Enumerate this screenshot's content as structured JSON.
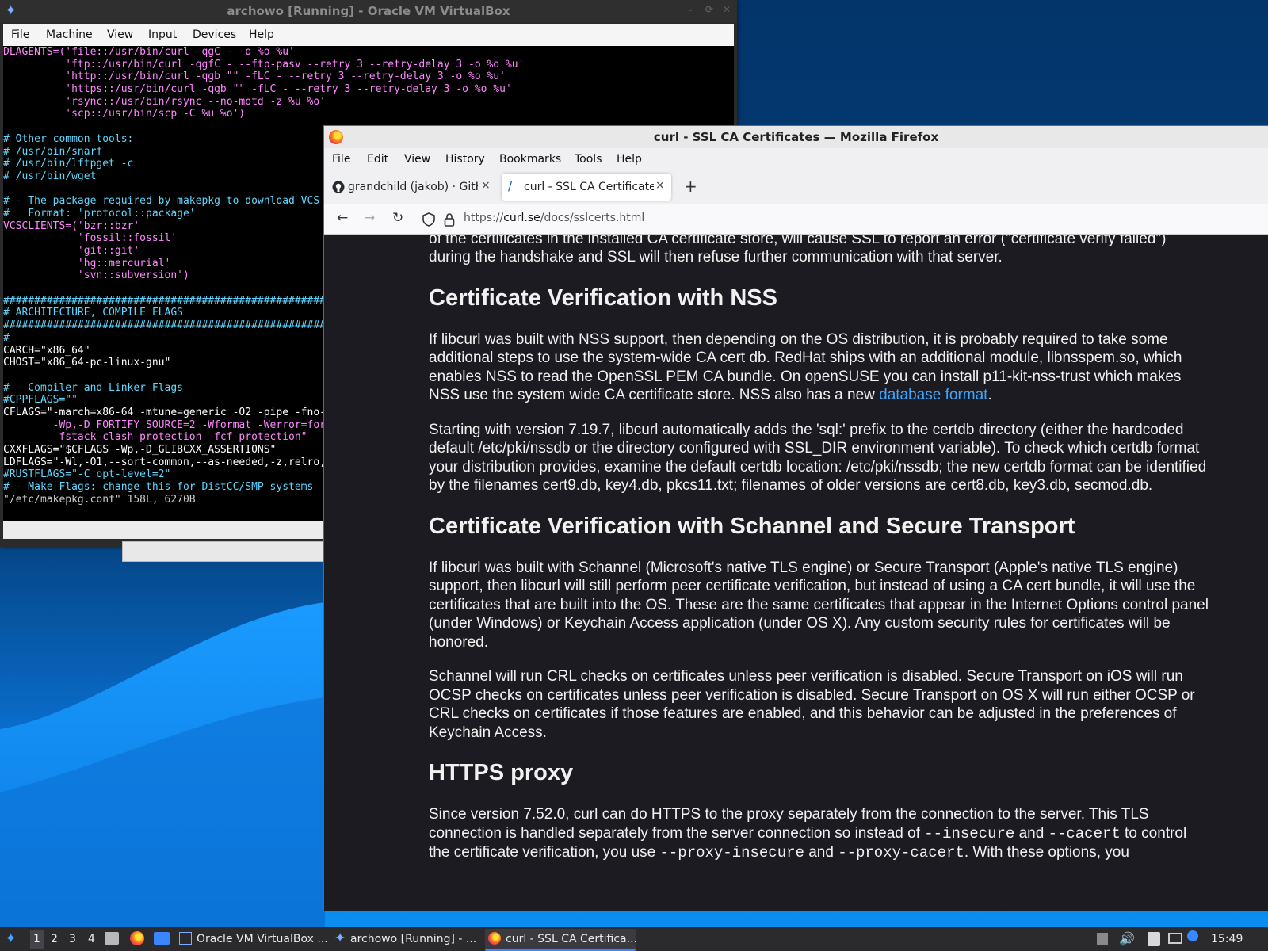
{
  "vbox": {
    "title": "archowo [Running] - Oracle VM VirtualBox",
    "menu": [
      "File",
      "Machine",
      "View",
      "Input",
      "Devices",
      "Help"
    ],
    "terminal_lines": [
      {
        "c": "t-s",
        "t": "DLAGENTS=('file::/usr/bin/curl -qgC - -o %o %u'"
      },
      {
        "c": "t-s",
        "t": "          'ftp::/usr/bin/curl -qgfC - --ftp-pasv --retry 3 --retry-delay 3 -o %o %u'"
      },
      {
        "c": "t-s",
        "t": "          'http::/usr/bin/curl -qgb \"\" -fLC - --retry 3 --retry-delay 3 -o %o %u'"
      },
      {
        "c": "t-s",
        "t": "          'https::/usr/bin/curl -qgb \"\" -fLC - --retry 3 --retry-delay 3 -o %o %u'"
      },
      {
        "c": "t-s",
        "t": "          'rsync::/usr/bin/rsync --no-motd -z %u %o'"
      },
      {
        "c": "t-s",
        "t": "          'scp::/usr/bin/scp -C %u %o')"
      },
      {
        "c": "t-c",
        "t": ""
      },
      {
        "c": "t-c",
        "t": "# Other common tools:"
      },
      {
        "c": "t-c",
        "t": "# /usr/bin/snarf"
      },
      {
        "c": "t-c",
        "t": "# /usr/bin/lftpget -c"
      },
      {
        "c": "t-c",
        "t": "# /usr/bin/wget"
      },
      {
        "c": "t-c",
        "t": ""
      },
      {
        "c": "t-c",
        "t": "#-- The package required by makepkg to download VCS"
      },
      {
        "c": "t-c",
        "t": "#   Format: 'protocol::package'"
      },
      {
        "c": "t-s",
        "t": "VCSCLIENTS=('bzr::bzr'"
      },
      {
        "c": "t-s",
        "t": "            'fossil::fossil'"
      },
      {
        "c": "t-s",
        "t": "            'git::git'"
      },
      {
        "c": "t-s",
        "t": "            'hg::mercurial'"
      },
      {
        "c": "t-s",
        "t": "            'svn::subversion')"
      },
      {
        "c": "t-c",
        "t": ""
      },
      {
        "c": "t-c",
        "t": "####################################################"
      },
      {
        "c": "t-c",
        "t": "# ARCHITECTURE, COMPILE FLAGS"
      },
      {
        "c": "t-c",
        "t": "####################################################"
      },
      {
        "c": "t-c",
        "t": "#"
      },
      {
        "c": "t-w",
        "t": "CARCH=\"x86_64\""
      },
      {
        "c": "t-w",
        "t": "CHOST=\"x86_64-pc-linux-gnu\""
      },
      {
        "c": "t-c",
        "t": ""
      },
      {
        "c": "t-c",
        "t": "#-- Compiler and Linker Flags"
      },
      {
        "c": "t-c",
        "t": "#CPPFLAGS=\"\""
      },
      {
        "c": "t-w",
        "t": "CFLAGS=\"-march=x86-64 -mtune=generic -O2 -pipe -fno-"
      },
      {
        "c": "t-s",
        "t": "        -Wp,-D_FORTIFY_SOURCE=2 -Wformat -Werror=for"
      },
      {
        "c": "t-s",
        "t": "        -fstack-clash-protection -fcf-protection\""
      },
      {
        "c": "t-w",
        "t": "CXXFLAGS=\"$CFLAGS -Wp,-D_GLIBCXX_ASSERTIONS\""
      },
      {
        "c": "t-w",
        "t": "LDFLAGS=\"-Wl,-O1,--sort-common,--as-needed,-z,relro,"
      },
      {
        "c": "t-c",
        "t": "#RUSTFLAGS=\"-C opt-level=2\""
      },
      {
        "c": "t-c",
        "t": "#-- Make Flags: change this for DistCC/SMP systems"
      },
      {
        "c": "t-g",
        "t": "\"/etc/makepkg.conf\" 158L, 6270B"
      }
    ]
  },
  "firefox": {
    "title": "curl - SSL CA Certificates — Mozilla Firefox",
    "menu": [
      "File",
      "Edit",
      "View",
      "History",
      "Bookmarks",
      "Tools",
      "Help"
    ],
    "tabs": [
      {
        "label": "grandchild (jakob) · GitHub",
        "active": false
      },
      {
        "label": "curl - SSL CA Certificates",
        "active": true
      }
    ],
    "new_tab": "+",
    "url_prefix": "https://",
    "url_host": "curl.se",
    "url_path": "/docs/sslcerts.html",
    "content": {
      "p0": "Neglecting to use one of the above methods when dealing with a server using a certificate that is not signed by one of the certificates in the installed CA certificate store, will cause SSL to report an error (\"certificate verify failed\") during the handshake and SSL will then refuse further communication with that server.",
      "h_nss": "Certificate Verification with NSS",
      "p_nss1_a": "If libcurl was built with NSS support, then depending on the OS distribution, it is probably required to take some additional steps to use the system-wide CA cert db. RedHat ships with an additional module, libnsspem.so, which enables NSS to read the OpenSSL PEM CA bundle. On openSUSE you can install p11-kit-nss-trust which makes NSS use the system wide CA certificate store. NSS also has a new ",
      "p_nss1_link": "database format",
      "p_nss1_b": ".",
      "p_nss2": "Starting with version 7.19.7, libcurl automatically adds the 'sql:' prefix to the certdb directory (either the hardcoded default /etc/pki/nssdb or the directory configured with SSL_DIR environment variable). To check which certdb format your distribution provides, examine the default certdb location: /etc/pki/nssdb; the new certdb format can be identified by the filenames cert9.db, key4.db, pkcs11.txt; filenames of older versions are cert8.db, key3.db, secmod.db.",
      "h_schannel": "Certificate Verification with Schannel and Secure Transport",
      "p_sch1": "If libcurl was built with Schannel (Microsoft's native TLS engine) or Secure Transport (Apple's native TLS engine) support, then libcurl will still perform peer certificate verification, but instead of using a CA cert bundle, it will use the certificates that are built into the OS. These are the same certificates that appear in the Internet Options control panel (under Windows) or Keychain Access application (under OS X). Any custom security rules for certificates will be honored.",
      "p_sch2": "Schannel will run CRL checks on certificates unless peer verification is disabled. Secure Transport on iOS will run OCSP checks on certificates unless peer verification is disabled. Secure Transport on OS X will run either OCSP or CRL checks on certificates if those features are enabled, and this behavior can be adjusted in the preferences of Keychain Access.",
      "h_proxy": "HTTPS proxy",
      "p_proxy_a": "Since version 7.52.0, curl can do HTTPS to the proxy separately from the connection to the server. This TLS connection is handled separately from the server connection so instead of ",
      "c_insecure": "--insecure",
      "p_proxy_and1": " and ",
      "c_cacert": "--cacert",
      "p_proxy_b": " to control the certificate verification, you use ",
      "c_proxy_insecure": "--proxy-insecure",
      "p_proxy_and2": " and ",
      "c_proxy_cacert": "--proxy-cacert",
      "p_proxy_c": ". With these options, you"
    }
  },
  "taskbar": {
    "workspaces": [
      "1",
      "2",
      "3",
      "4"
    ],
    "tasks": [
      {
        "label": "Oracle VM VirtualBox ..."
      },
      {
        "label": "archowo [Running] - ..."
      },
      {
        "label": "curl - SSL CA Certifica..."
      }
    ],
    "clock": "15:49"
  },
  "colors": {
    "accent": "#3a86ff",
    "link": "#3ea6ff",
    "page_bg": "#1c1b22"
  }
}
